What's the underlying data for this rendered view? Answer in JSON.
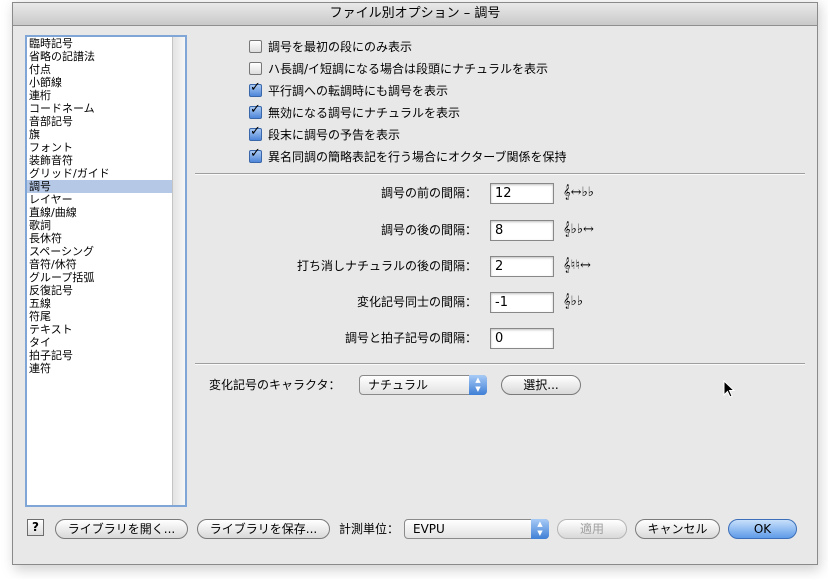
{
  "window": {
    "title": "ファイル別オプション – 調号"
  },
  "sidebar": {
    "items": [
      "臨時記号",
      "省略の記譜法",
      "付点",
      "小節線",
      "連桁",
      "コードネーム",
      "音部記号",
      "旗",
      "フォント",
      "装飾音符",
      "グリッド/ガイド",
      "調号",
      "レイヤー",
      "直線/曲線",
      "歌詞",
      "長休符",
      "スペーシング",
      "音符/休符",
      "グループ括弧",
      "反復記号",
      "五線",
      "符尾",
      "テキスト",
      "タイ",
      "拍子記号",
      "連符"
    ],
    "selected": "調号"
  },
  "checkboxes": [
    {
      "label": "調号を最初の段にのみ表示",
      "checked": false
    },
    {
      "label": "ハ長調/イ短調になる場合は段頭にナチュラルを表示",
      "checked": false
    },
    {
      "label": "平行調への転調時にも調号を表示",
      "checked": true
    },
    {
      "label": "無効になる調号にナチュラルを表示",
      "checked": true
    },
    {
      "label": "段末に調号の予告を表示",
      "checked": true
    },
    {
      "label": "異名同調の簡略表記を行う場合にオクターブ関係を保持",
      "checked": true
    }
  ],
  "fields": [
    {
      "label": "調号の前の間隔：",
      "value": "12",
      "glyph": "𝄞↔♭♭"
    },
    {
      "label": "調号の後の間隔：",
      "value": "8",
      "glyph": "𝄞♭♭↔"
    },
    {
      "label": "打ち消しナチュラルの後の間隔：",
      "value": "2",
      "glyph": "𝄞♮♮↔"
    },
    {
      "label": "変化記号同士の間隔：",
      "value": "-1",
      "glyph": "𝄞♭♭"
    },
    {
      "label": "調号と拍子記号の間隔：",
      "value": "0",
      "glyph": ""
    }
  ],
  "accidental": {
    "label": "変化記号のキャラクタ：",
    "value": "ナチュラル",
    "select_button": "選択..."
  },
  "footer": {
    "help": "?",
    "open_library": "ライブラリを開く...",
    "save_library": "ライブラリを保存...",
    "units_label": "計測単位：",
    "units_value": "EVPU",
    "apply": "適用",
    "cancel": "キャンセル",
    "ok": "OK"
  },
  "colors": {
    "selection": "#b5c8e6",
    "accent": "#5e9be8",
    "sidebar_border": "#7fa6d6"
  }
}
